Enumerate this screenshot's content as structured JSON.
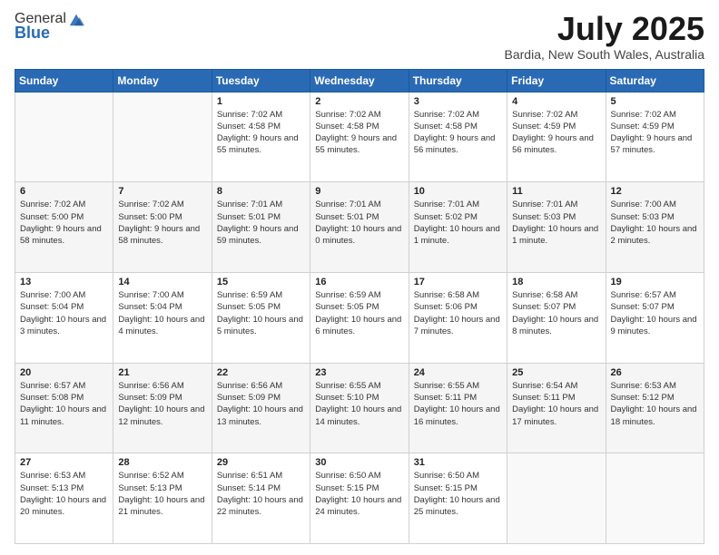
{
  "header": {
    "logo_general": "General",
    "logo_blue": "Blue",
    "title": "July 2025",
    "subtitle": "Bardia, New South Wales, Australia"
  },
  "calendar": {
    "days_of_week": [
      "Sunday",
      "Monday",
      "Tuesday",
      "Wednesday",
      "Thursday",
      "Friday",
      "Saturday"
    ],
    "weeks": [
      [
        {
          "day": "",
          "info": ""
        },
        {
          "day": "",
          "info": ""
        },
        {
          "day": "1",
          "info": "Sunrise: 7:02 AM\nSunset: 4:58 PM\nDaylight: 9 hours\nand 55 minutes."
        },
        {
          "day": "2",
          "info": "Sunrise: 7:02 AM\nSunset: 4:58 PM\nDaylight: 9 hours\nand 55 minutes."
        },
        {
          "day": "3",
          "info": "Sunrise: 7:02 AM\nSunset: 4:58 PM\nDaylight: 9 hours\nand 56 minutes."
        },
        {
          "day": "4",
          "info": "Sunrise: 7:02 AM\nSunset: 4:59 PM\nDaylight: 9 hours\nand 56 minutes."
        },
        {
          "day": "5",
          "info": "Sunrise: 7:02 AM\nSunset: 4:59 PM\nDaylight: 9 hours\nand 57 minutes."
        }
      ],
      [
        {
          "day": "6",
          "info": "Sunrise: 7:02 AM\nSunset: 5:00 PM\nDaylight: 9 hours\nand 58 minutes."
        },
        {
          "day": "7",
          "info": "Sunrise: 7:02 AM\nSunset: 5:00 PM\nDaylight: 9 hours\nand 58 minutes."
        },
        {
          "day": "8",
          "info": "Sunrise: 7:01 AM\nSunset: 5:01 PM\nDaylight: 9 hours\nand 59 minutes."
        },
        {
          "day": "9",
          "info": "Sunrise: 7:01 AM\nSunset: 5:01 PM\nDaylight: 10 hours\nand 0 minutes."
        },
        {
          "day": "10",
          "info": "Sunrise: 7:01 AM\nSunset: 5:02 PM\nDaylight: 10 hours\nand 1 minute."
        },
        {
          "day": "11",
          "info": "Sunrise: 7:01 AM\nSunset: 5:03 PM\nDaylight: 10 hours\nand 1 minute."
        },
        {
          "day": "12",
          "info": "Sunrise: 7:00 AM\nSunset: 5:03 PM\nDaylight: 10 hours\nand 2 minutes."
        }
      ],
      [
        {
          "day": "13",
          "info": "Sunrise: 7:00 AM\nSunset: 5:04 PM\nDaylight: 10 hours\nand 3 minutes."
        },
        {
          "day": "14",
          "info": "Sunrise: 7:00 AM\nSunset: 5:04 PM\nDaylight: 10 hours\nand 4 minutes."
        },
        {
          "day": "15",
          "info": "Sunrise: 6:59 AM\nSunset: 5:05 PM\nDaylight: 10 hours\nand 5 minutes."
        },
        {
          "day": "16",
          "info": "Sunrise: 6:59 AM\nSunset: 5:05 PM\nDaylight: 10 hours\nand 6 minutes."
        },
        {
          "day": "17",
          "info": "Sunrise: 6:58 AM\nSunset: 5:06 PM\nDaylight: 10 hours\nand 7 minutes."
        },
        {
          "day": "18",
          "info": "Sunrise: 6:58 AM\nSunset: 5:07 PM\nDaylight: 10 hours\nand 8 minutes."
        },
        {
          "day": "19",
          "info": "Sunrise: 6:57 AM\nSunset: 5:07 PM\nDaylight: 10 hours\nand 9 minutes."
        }
      ],
      [
        {
          "day": "20",
          "info": "Sunrise: 6:57 AM\nSunset: 5:08 PM\nDaylight: 10 hours\nand 11 minutes."
        },
        {
          "day": "21",
          "info": "Sunrise: 6:56 AM\nSunset: 5:09 PM\nDaylight: 10 hours\nand 12 minutes."
        },
        {
          "day": "22",
          "info": "Sunrise: 6:56 AM\nSunset: 5:09 PM\nDaylight: 10 hours\nand 13 minutes."
        },
        {
          "day": "23",
          "info": "Sunrise: 6:55 AM\nSunset: 5:10 PM\nDaylight: 10 hours\nand 14 minutes."
        },
        {
          "day": "24",
          "info": "Sunrise: 6:55 AM\nSunset: 5:11 PM\nDaylight: 10 hours\nand 16 minutes."
        },
        {
          "day": "25",
          "info": "Sunrise: 6:54 AM\nSunset: 5:11 PM\nDaylight: 10 hours\nand 17 minutes."
        },
        {
          "day": "26",
          "info": "Sunrise: 6:53 AM\nSunset: 5:12 PM\nDaylight: 10 hours\nand 18 minutes."
        }
      ],
      [
        {
          "day": "27",
          "info": "Sunrise: 6:53 AM\nSunset: 5:13 PM\nDaylight: 10 hours\nand 20 minutes."
        },
        {
          "day": "28",
          "info": "Sunrise: 6:52 AM\nSunset: 5:13 PM\nDaylight: 10 hours\nand 21 minutes."
        },
        {
          "day": "29",
          "info": "Sunrise: 6:51 AM\nSunset: 5:14 PM\nDaylight: 10 hours\nand 22 minutes."
        },
        {
          "day": "30",
          "info": "Sunrise: 6:50 AM\nSunset: 5:15 PM\nDaylight: 10 hours\nand 24 minutes."
        },
        {
          "day": "31",
          "info": "Sunrise: 6:50 AM\nSunset: 5:15 PM\nDaylight: 10 hours\nand 25 minutes."
        },
        {
          "day": "",
          "info": ""
        },
        {
          "day": "",
          "info": ""
        }
      ]
    ]
  }
}
